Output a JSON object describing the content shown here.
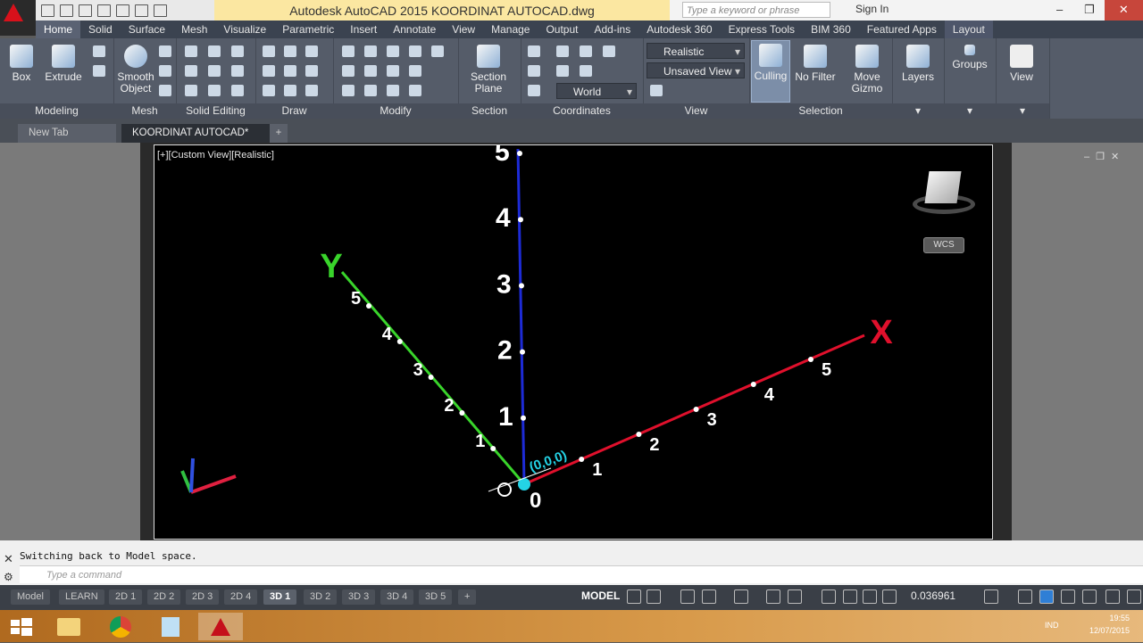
{
  "app": {
    "title": "Autodesk AutoCAD 2015    KOORDINAT AUTOCAD.dwg",
    "search_placeholder": "Type a keyword or phrase",
    "sign_in": "Sign In"
  },
  "ribbon_tabs": [
    "Home",
    "Solid",
    "Surface",
    "Mesh",
    "Visualize",
    "Parametric",
    "Insert",
    "Annotate",
    "View",
    "Manage",
    "Output",
    "Add-ins",
    "Autodesk 360",
    "Express Tools",
    "BIM 360",
    "Featured Apps",
    "Layout"
  ],
  "panels": {
    "modeling": {
      "title": "Modeling",
      "box": "Box",
      "extrude": "Extrude"
    },
    "mesh": {
      "title": "Mesh",
      "smooth": "Smooth Object"
    },
    "solid_editing": {
      "title": "Solid Editing"
    },
    "draw": {
      "title": "Draw"
    },
    "modify": {
      "title": "Modify"
    },
    "section": {
      "title": "Section",
      "section_plane": "Section Plane"
    },
    "coordinates": {
      "title": "Coordinates",
      "world": "World"
    },
    "view": {
      "title": "View",
      "visual_style": "Realistic",
      "saved_view": "Unsaved View"
    },
    "selection": {
      "title": "Selection",
      "culling": "Culling",
      "no_filter": "No Filter",
      "move_gizmo": "Move Gizmo"
    },
    "layers": "Layers",
    "groups": "Groups",
    "view_btn": "View"
  },
  "doc_tabs": {
    "new_tab": "New Tab",
    "active": "KOORDINAT AUTOCAD*",
    "plus": "+"
  },
  "viewport": {
    "label": "[+][Custom View][Realistic]",
    "origin_label": "(0,0,0)",
    "zero": "0",
    "axis_x": "X",
    "axis_y": "Y",
    "x_ticks": [
      "1",
      "2",
      "3",
      "4",
      "5"
    ],
    "y_ticks": [
      "1",
      "2",
      "3",
      "4",
      "5"
    ],
    "z_ticks": [
      "1",
      "2",
      "3",
      "4",
      "5"
    ],
    "wcs": "WCS",
    "colors": {
      "x": "#e0102c",
      "y": "#39d42b",
      "z": "#1d2bd6",
      "origin": "#24d3e6"
    }
  },
  "command": {
    "history": "Switching back to Model space.",
    "placeholder": "Type a command"
  },
  "layout_tabs": [
    "Model",
    "LEARN",
    "2D 1",
    "2D 2",
    "2D 3",
    "2D 4",
    "3D 1",
    "3D 2",
    "3D 3",
    "3D 4",
    "3D 5",
    "+"
  ],
  "status": {
    "model": "MODEL",
    "scale": "0.036961"
  },
  "taskbar": {
    "lang": "IND",
    "time": "19:55",
    "date": "12/07/2015"
  }
}
